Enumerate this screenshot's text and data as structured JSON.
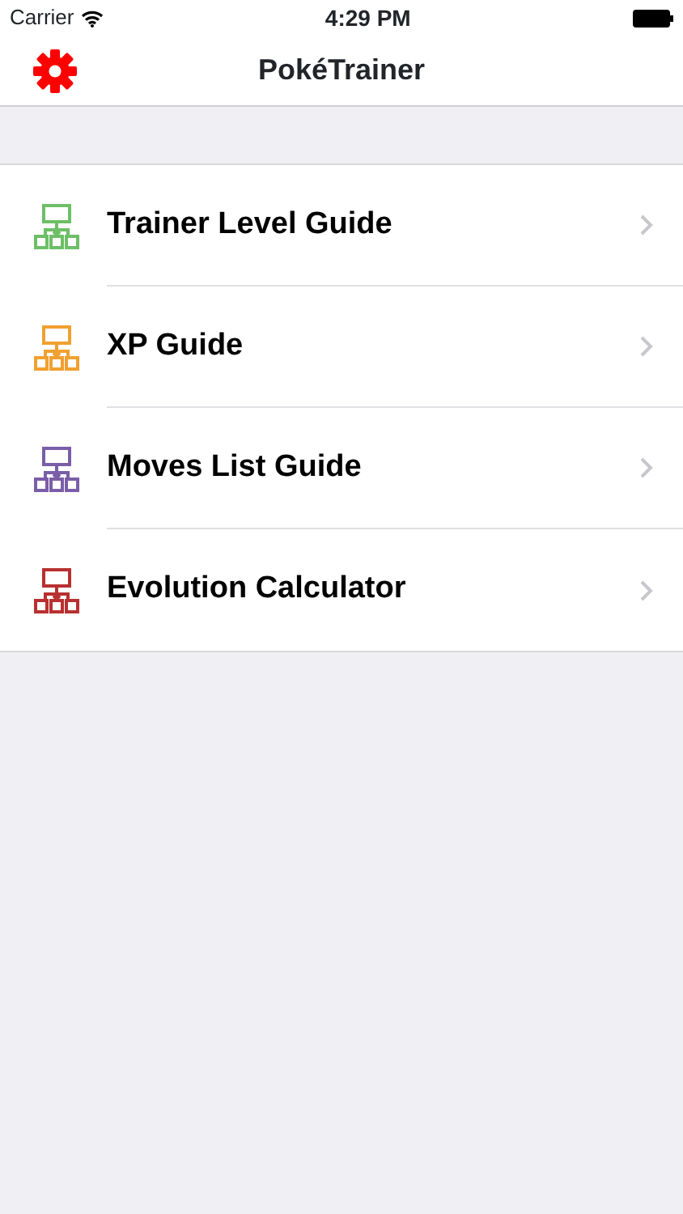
{
  "status_bar": {
    "carrier": "Carrier",
    "time": "4:29 PM"
  },
  "nav_bar": {
    "title": "PokéTrainer"
  },
  "menu": [
    {
      "label": "Trainer Level Guide",
      "color": "#6dbf67"
    },
    {
      "label": "XP Guide",
      "color": "#f0a030"
    },
    {
      "label": "Moves List Guide",
      "color": "#7a5ea8"
    },
    {
      "label": "Evolution Calculator",
      "color": "#b83030"
    }
  ]
}
